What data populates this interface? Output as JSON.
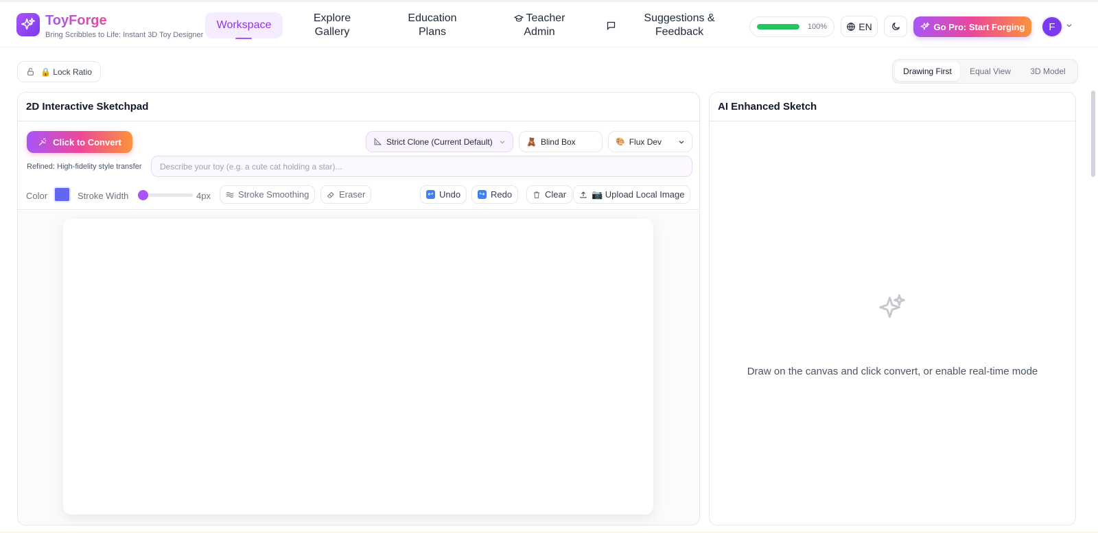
{
  "brand": {
    "name": "ToyForge",
    "tagline": "Bring Scribbles to Life: Instant 3D Toy Designer"
  },
  "nav": {
    "workspace": "Workspace",
    "explore_l1": "Explore",
    "explore_l2": "Gallery",
    "education_l1": "Education",
    "education_l2": "Plans",
    "teacher_l1": "Teacher",
    "teacher_l2": "Admin",
    "suggestions_l1": "Suggestions &",
    "suggestions_l2": "Feedback"
  },
  "header": {
    "progress_value": 1.0,
    "progress_label": "100%",
    "language": "EN",
    "pro_button": "Go Pro: Start Forging",
    "avatar_initial": "F"
  },
  "toolbar": {
    "lock_ratio": "🔒 Lock Ratio",
    "views": [
      "Drawing First",
      "Equal View",
      "3D Model"
    ],
    "active_view": "Drawing First"
  },
  "left_panel": {
    "title": "2D Interactive Sketchpad",
    "convert_button": "Click to Convert",
    "mode_select": "Strict Clone (Current Default)",
    "style_select": "Blind Box",
    "model_select": "Flux Dev",
    "refined_note": "Refined: High-fidelity style transfer",
    "prompt_placeholder": "Describe your toy (e.g. a cute cat holding a star)...",
    "prompt_value": "",
    "color_label": "Color",
    "color_value": "#6366f1",
    "stroke_width_label": "Stroke Width",
    "stroke_width_value": "4px",
    "stroke_smoothing": "Stroke Smoothing",
    "eraser": "Eraser",
    "undo": "Undo",
    "redo": "Redo",
    "clear": "Clear",
    "upload": "📷 Upload Local Image"
  },
  "right_panel": {
    "title": "AI Enhanced Sketch",
    "placeholder": "Draw on the canvas and click convert, or enable real-time mode"
  },
  "colors": {
    "accent": "#a855f7",
    "brand_gradient_end": "#fb923c",
    "progress": "#22c55e"
  }
}
